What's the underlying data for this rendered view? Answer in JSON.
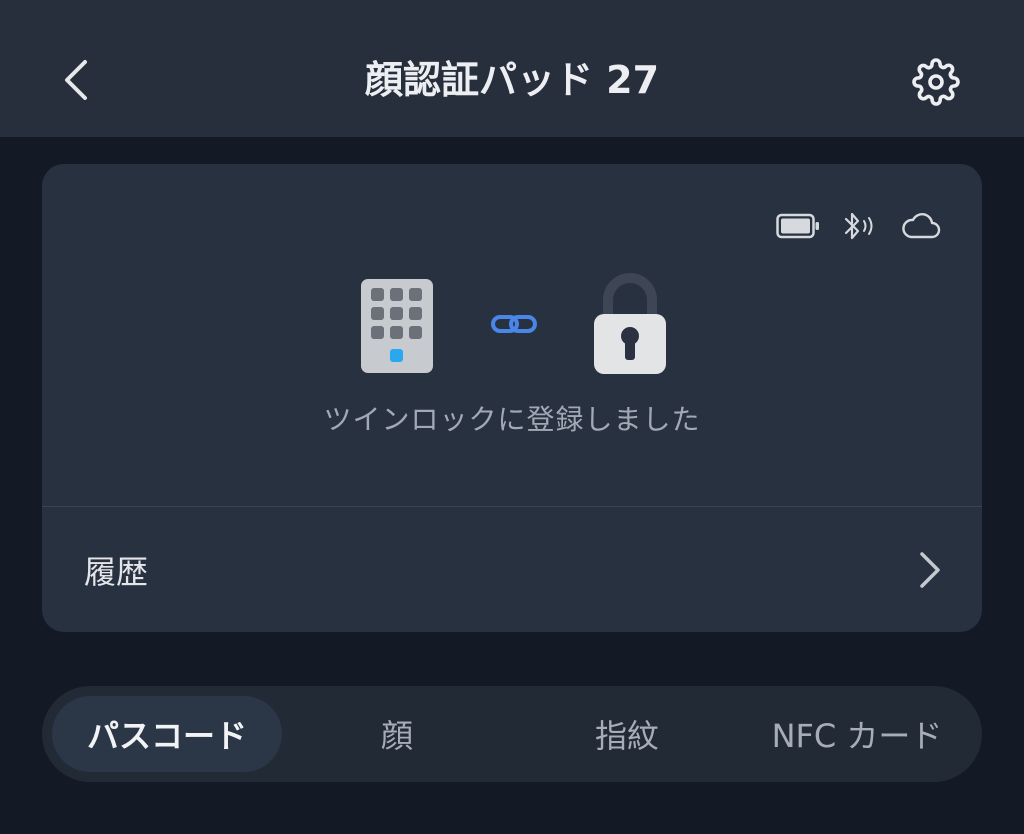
{
  "header": {
    "title": "顔認証パッド 27",
    "back_icon": "chevron-left-icon",
    "settings_icon": "gear-icon"
  },
  "device_card": {
    "status_icons": [
      "battery-icon",
      "bluetooth-icon",
      "cloud-icon"
    ],
    "battery_level": 0.9,
    "devices": [
      "keypad-icon",
      "link-icon",
      "padlock-icon"
    ],
    "message": "ツインロックに登録しました",
    "accent_color": "#4a86e8",
    "indicator_color": "#29a8f0"
  },
  "history": {
    "label": "履歴",
    "chevron_icon": "chevron-right-icon"
  },
  "tabs": [
    {
      "label": "パスコード",
      "active": true
    },
    {
      "label": "顔",
      "active": false
    },
    {
      "label": "指紋",
      "active": false
    },
    {
      "label": "NFC カード",
      "active": false
    }
  ]
}
